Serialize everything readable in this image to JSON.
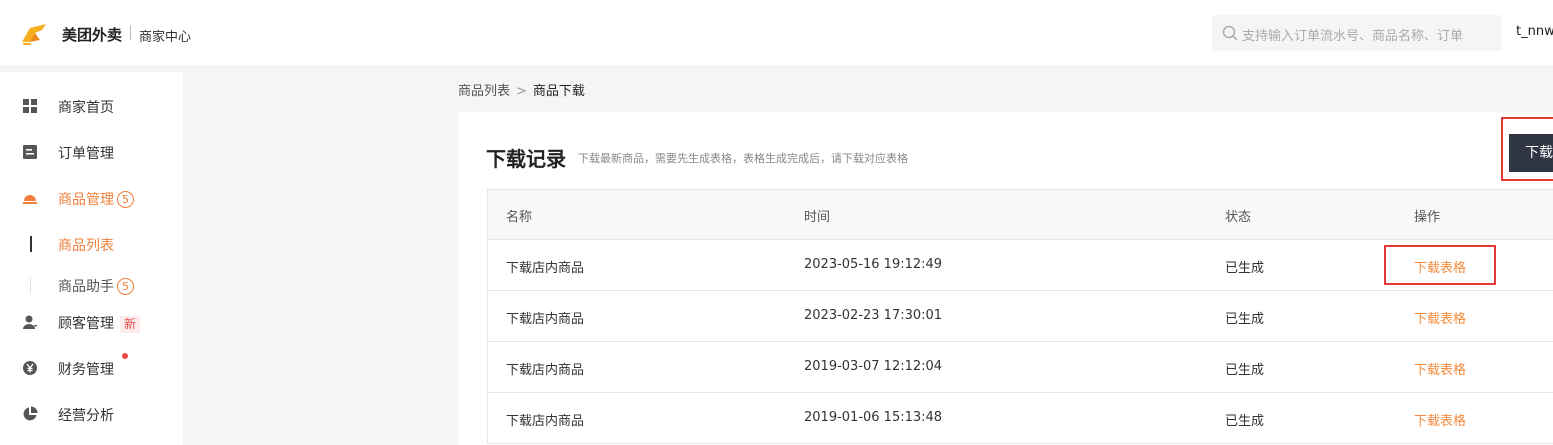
{
  "header": {
    "brand": "美团外卖",
    "subtitle": "商家中心",
    "search_placeholder": "支持输入订单流水号、商品名称、订单",
    "user": "t_nnw"
  },
  "sidebar": {
    "items": [
      {
        "label": "商家首页",
        "icon": "grid-icon"
      },
      {
        "label": "订单管理",
        "icon": "order-icon"
      },
      {
        "label": "商品管理",
        "icon": "dish-icon",
        "badge": "5",
        "active": true
      },
      {
        "label": "商品列表",
        "sub": true,
        "active": true
      },
      {
        "label": "商品助手",
        "sub": true,
        "badge": "5"
      },
      {
        "label": "顾客管理",
        "icon": "user-icon",
        "tag": "新"
      },
      {
        "label": "财务管理",
        "icon": "yen-icon",
        "dot": true
      },
      {
        "label": "经营分析",
        "icon": "pie-icon"
      }
    ]
  },
  "breadcrumb": {
    "parent": "商品列表",
    "separator": ">",
    "current": "商品下载"
  },
  "card": {
    "title": "下载记录",
    "hint": "下载最新商品，需要先生成表格，表格生成完成后，请下载对应表格",
    "button": "下载"
  },
  "table": {
    "headers": [
      "名称",
      "时间",
      "状态",
      "操作"
    ],
    "rows": [
      {
        "name": "下载店内商品",
        "time": "2023-05-16 19:12:49",
        "status": "已生成",
        "action": "下载表格"
      },
      {
        "name": "下载店内商品",
        "time": "2023-02-23 17:30:01",
        "status": "已生成",
        "action": "下载表格"
      },
      {
        "name": "下载店内商品",
        "time": "2019-03-07 12:12:04",
        "status": "已生成",
        "action": "下载表格"
      },
      {
        "name": "下载店内商品",
        "time": "2019-01-06 15:13:48",
        "status": "已生成",
        "action": "下载表格"
      }
    ]
  },
  "colors": {
    "accent": "#f07f3b",
    "highlight": "#e53935",
    "button": "#2f3542"
  }
}
